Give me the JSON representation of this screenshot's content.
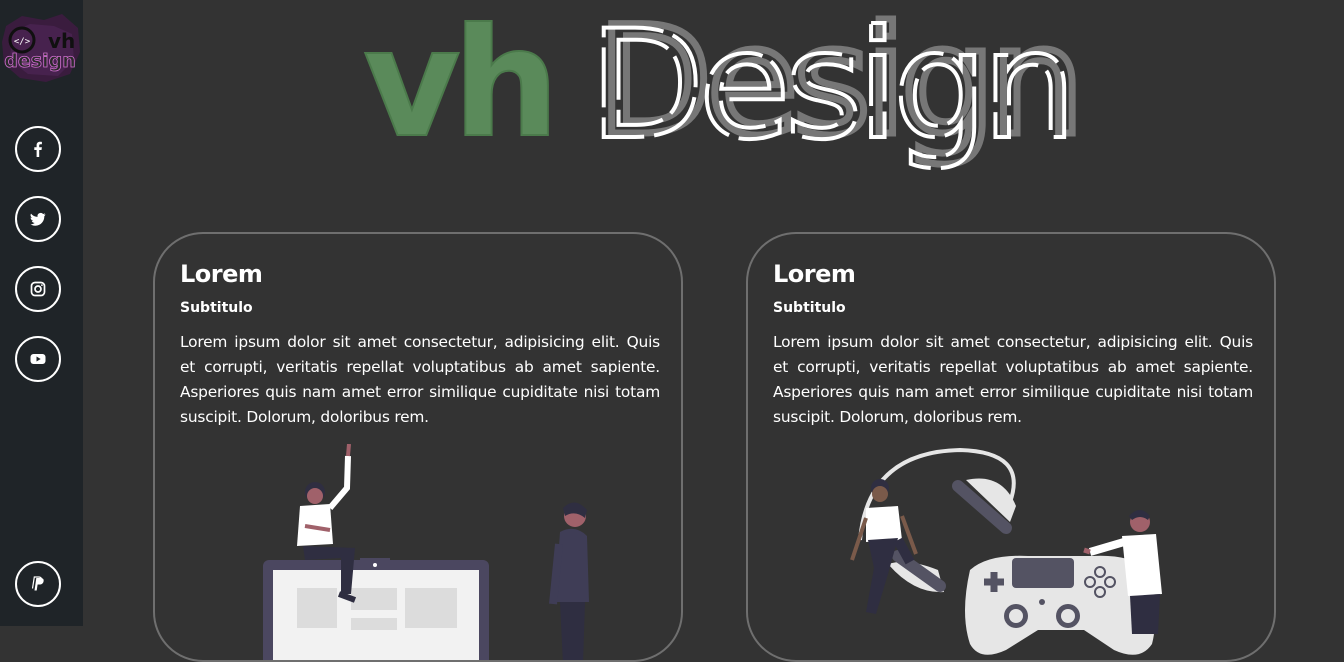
{
  "brand": {
    "logo_text": "design",
    "logo_code": "</>",
    "logo_letters": "vh"
  },
  "header": {
    "title_part1": "vh",
    "title_part2": "Design"
  },
  "sidebar": {
    "social": [
      {
        "name": "facebook",
        "icon": "facebook-icon"
      },
      {
        "name": "twitter",
        "icon": "twitter-icon"
      },
      {
        "name": "instagram",
        "icon": "instagram-icon"
      },
      {
        "name": "youtube",
        "icon": "youtube-icon"
      }
    ],
    "paypal_icon": "paypal-icon"
  },
  "cards": [
    {
      "title": "Lorem",
      "subtitle": "Subtitulo",
      "text": "Lorem ipsum dolor sit amet consectetur, adipisicing elit. Quis et corrupti, veritatis repellat voluptatibus ab amet sapiente. Asperiores quis nam amet error similique cupiditate nisi totam suscipit. Dolorum, doloribus rem.",
      "illustration": "people-with-monitor-illustration"
    },
    {
      "title": "Lorem",
      "subtitle": "Subtitulo",
      "text": "Lorem ipsum dolor sit amet consectetur, adipisicing elit. Quis et corrupti, veritatis repellat voluptatibus ab amet sapiente. Asperiores quis nam amet error similique cupiditate nisi totam suscipit. Dolorum, doloribus rem.",
      "illustration": "gamers-with-controller-illustration"
    }
  ],
  "colors": {
    "background": "#333333",
    "sidebar": "#1f2428",
    "accent_green": "#5a8a5a",
    "card_border": "#6f6f6f"
  }
}
